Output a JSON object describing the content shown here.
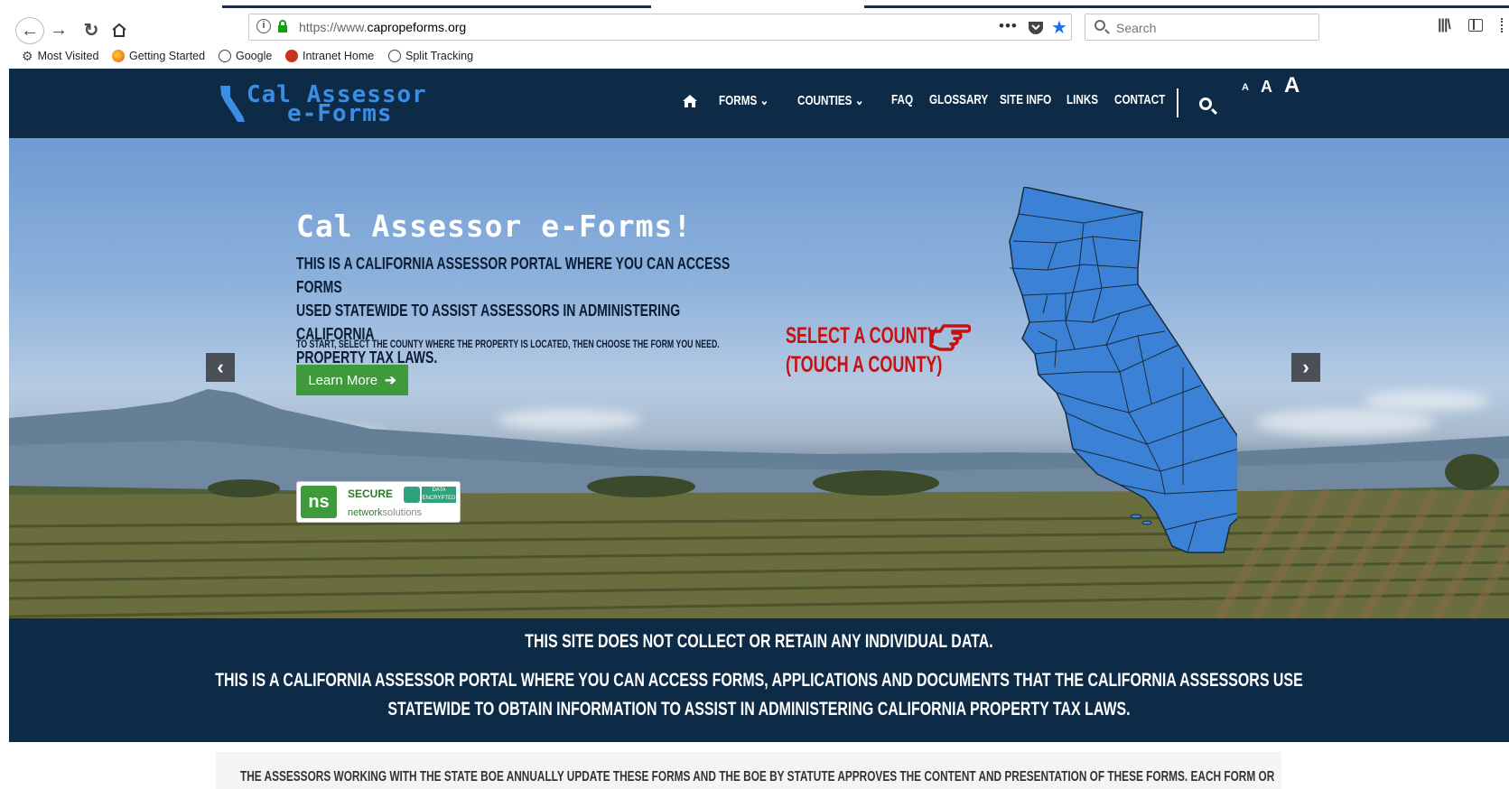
{
  "browser": {
    "url_prefix": "https://www.",
    "url_domain": "capropeforms.org",
    "search_placeholder": "Search",
    "bookmarks": [
      "Most Visited",
      "Getting Started",
      "Google",
      "Intranet Home",
      "Split Tracking"
    ]
  },
  "site": {
    "logo_line1": "Cal Assessor",
    "logo_line2": "e-Forms",
    "nav": {
      "forms": "FORMS",
      "counties": "COUNTIES",
      "faq": "FAQ",
      "glossary": "GLOSSARY",
      "site_info": "SITE INFO",
      "links": "LINKS",
      "contact": "CONTACT"
    },
    "font_sizes": [
      "A",
      "A",
      "A"
    ]
  },
  "hero": {
    "title": "Cal Assessor e-Forms!",
    "desc_line1": "THIS IS A CALIFORNIA ASSESSOR PORTAL WHERE YOU CAN ACCESS FORMS",
    "desc_line2": "USED STATEWIDE TO ASSIST ASSESSORS IN ADMINISTERING CALIFORNIA",
    "desc_line3": "PROPERTY TAX LAWS.",
    "start_text": "TO START, SELECT THE COUNTY WHERE THE PROPERTY IS LOCATED, THEN CHOOSE THE FORM YOU NEED.",
    "learn_more": "Learn More",
    "select_county_1": "SELECT A COUNTY",
    "select_county_2": "(TOUCH A COUNTY)",
    "prev": "‹",
    "next": "›",
    "seal": {
      "logo": "ns",
      "secure": "SECURE",
      "encrypted": "DATA ENCRYPTED",
      "brand_1": "network",
      "brand_2": "solutions"
    }
  },
  "info": {
    "line1": "THIS SITE DOES NOT COLLECT OR RETAIN ANY INDIVIDUAL DATA.",
    "line2": "THIS IS A CALIFORNIA ASSESSOR PORTAL WHERE YOU CAN ACCESS FORMS, APPLICATIONS AND DOCUMENTS THAT THE CALIFORNIA ASSESSORS USE",
    "line3": "STATEWIDE TO OBTAIN INFORMATION TO ASSIST IN ADMINISTERING CALIFORNIA PROPERTY TAX LAWS."
  },
  "lower": {
    "text": "THE ASSESSORS WORKING WITH THE STATE BOE ANNUALLY UPDATE THESE FORMS AND THE BOE BY STATUTE APPROVES THE CONTENT AND PRESENTATION OF THESE FORMS. EACH FORM OR"
  },
  "colors": {
    "navy": "#0d2a46",
    "logo_blue": "#3a8ee6",
    "button_green": "#3f9a3b",
    "cta_red": "#c71010",
    "map_blue": "#3b82d6"
  }
}
